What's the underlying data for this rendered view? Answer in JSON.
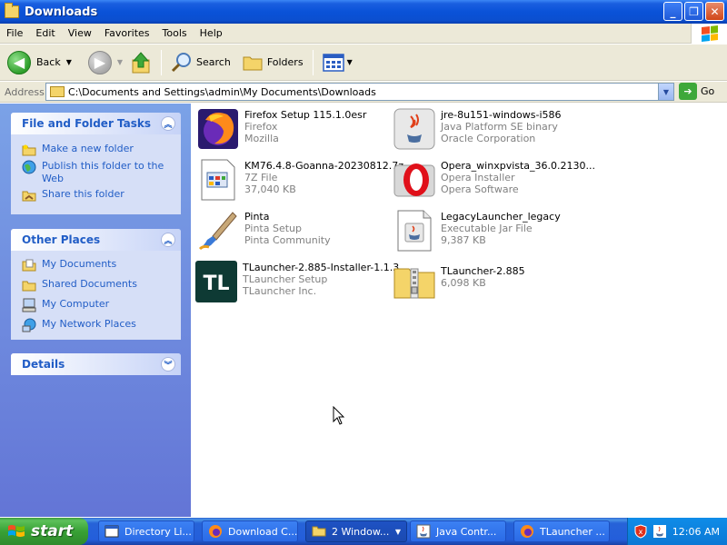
{
  "window": {
    "title": "Downloads"
  },
  "menu": [
    "File",
    "Edit",
    "View",
    "Favorites",
    "Tools",
    "Help"
  ],
  "toolbar": {
    "back": "Back",
    "search": "Search",
    "folders": "Folders"
  },
  "address": {
    "label": "Address",
    "path": "C:\\Documents and Settings\\admin\\My Documents\\Downloads",
    "go": "Go"
  },
  "tasks": {
    "title": "File and Folder Tasks",
    "items": [
      "Make a new folder",
      "Publish this folder to the Web",
      "Share this folder"
    ]
  },
  "places": {
    "title": "Other Places",
    "items": [
      "My Documents",
      "Shared Documents",
      "My Computer",
      "My Network Places"
    ]
  },
  "details": {
    "title": "Details"
  },
  "files": [
    {
      "name": "Firefox Setup 115.1.0esr",
      "line2": "Firefox",
      "line3": "Mozilla",
      "icon": "firefox-icon"
    },
    {
      "name": "jre-8u151-windows-i586",
      "line2": "Java Platform SE binary",
      "line3": "Oracle Corporation",
      "icon": "java-icon"
    },
    {
      "name": "KM76.4.8-Goanna-20230812.7z",
      "line2": "7Z File",
      "line3": "37,040 KB",
      "icon": "archive-file-icon"
    },
    {
      "name": "Opera_winxpvista_36.0.2130...",
      "line2": "Opera Installer",
      "line3": "Opera Software",
      "icon": "opera-icon"
    },
    {
      "name": "Pinta",
      "line2": "Pinta Setup",
      "line3": "Pinta Community",
      "icon": "pinta-icon"
    },
    {
      "name": "LegacyLauncher_legacy",
      "line2": "Executable Jar File",
      "line3": "9,387 KB",
      "icon": "jar-file-icon"
    },
    {
      "name": "TLauncher-2.885-Installer-1.1.3",
      "line2": "TLauncher Setup",
      "line3": "TLauncher Inc.",
      "icon": "tlauncher-icon"
    },
    {
      "name": "TLauncher-2.885",
      "line2": "6,098 KB",
      "line3": "",
      "icon": "zip-folder-icon"
    }
  ],
  "taskbar": {
    "start": "start",
    "tasks": [
      "Directory Li...",
      "Download C...",
      "2 Window...",
      "Java Contr...",
      "TLauncher ..."
    ],
    "clock": "12:06 AM"
  }
}
